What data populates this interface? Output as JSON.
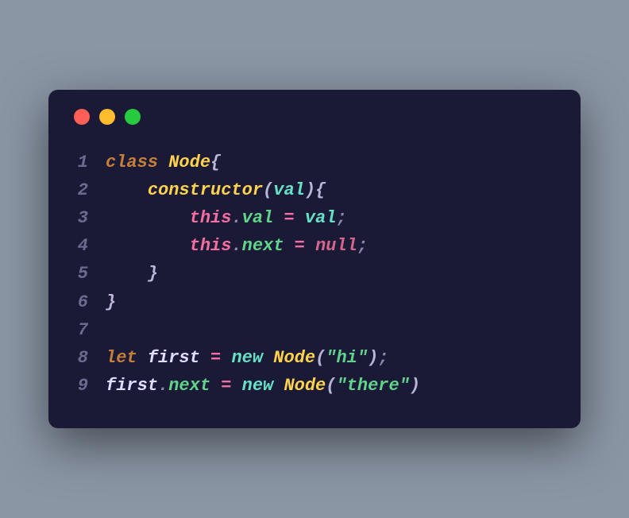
{
  "window": {
    "traffic_lights": {
      "red": "#ff5f56",
      "yellow": "#ffbd2e",
      "green": "#27c93f"
    }
  },
  "editor": {
    "background": "#1b1a36",
    "lineno_color": "#6b6a8f",
    "colors": {
      "keyword": "#c67f3b",
      "class": "#ffd34e",
      "func": "#ffd34e",
      "param": "#66e0c6",
      "this": "#f46ea1",
      "prop": "#5fd48a",
      "op": "#f46ea1",
      "null": "#d4658c",
      "brace": "#b9b6d6",
      "punct": "#8c89b0",
      "let": "#c67f3b",
      "ident": "#e0dcff",
      "new": "#66e0c6",
      "string": "#5fd48a",
      "dot": "#8c89b0"
    },
    "lines": [
      {
        "n": "1",
        "indent": 0,
        "tokens": [
          {
            "t": "class ",
            "c": "keyword"
          },
          {
            "t": "Node",
            "c": "class"
          },
          {
            "t": "{",
            "c": "brace"
          }
        ]
      },
      {
        "n": "2",
        "indent": 1,
        "tokens": [
          {
            "t": "constructor",
            "c": "func"
          },
          {
            "t": "(",
            "c": "brace"
          },
          {
            "t": "val",
            "c": "param"
          },
          {
            "t": ")",
            "c": "brace"
          },
          {
            "t": "{",
            "c": "brace"
          }
        ]
      },
      {
        "n": "3",
        "indent": 2,
        "tokens": [
          {
            "t": "this",
            "c": "this"
          },
          {
            "t": ".",
            "c": "dot"
          },
          {
            "t": "val",
            "c": "prop"
          },
          {
            "t": " = ",
            "c": "op"
          },
          {
            "t": "val",
            "c": "param"
          },
          {
            "t": ";",
            "c": "punct"
          }
        ]
      },
      {
        "n": "4",
        "indent": 2,
        "tokens": [
          {
            "t": "this",
            "c": "this"
          },
          {
            "t": ".",
            "c": "dot"
          },
          {
            "t": "next",
            "c": "prop"
          },
          {
            "t": " = ",
            "c": "op"
          },
          {
            "t": "null",
            "c": "null"
          },
          {
            "t": ";",
            "c": "punct"
          }
        ]
      },
      {
        "n": "5",
        "indent": 1,
        "tokens": [
          {
            "t": "}",
            "c": "brace"
          }
        ]
      },
      {
        "n": "6",
        "indent": 0,
        "tokens": [
          {
            "t": "}",
            "c": "brace"
          }
        ]
      },
      {
        "n": "7",
        "indent": 0,
        "tokens": []
      },
      {
        "n": "8",
        "indent": 0,
        "tokens": [
          {
            "t": "let ",
            "c": "let"
          },
          {
            "t": "first",
            "c": "ident"
          },
          {
            "t": " = ",
            "c": "op"
          },
          {
            "t": "new ",
            "c": "new"
          },
          {
            "t": "Node",
            "c": "class"
          },
          {
            "t": "(",
            "c": "brace"
          },
          {
            "t": "\"hi\"",
            "c": "string"
          },
          {
            "t": ")",
            "c": "brace"
          },
          {
            "t": ";",
            "c": "punct"
          }
        ]
      },
      {
        "n": "9",
        "indent": 0,
        "tokens": [
          {
            "t": "first",
            "c": "ident"
          },
          {
            "t": ".",
            "c": "dot"
          },
          {
            "t": "next",
            "c": "prop"
          },
          {
            "t": " = ",
            "c": "op"
          },
          {
            "t": "new ",
            "c": "new"
          },
          {
            "t": "Node",
            "c": "class"
          },
          {
            "t": "(",
            "c": "brace"
          },
          {
            "t": "\"there\"",
            "c": "string"
          },
          {
            "t": ")",
            "c": "brace"
          }
        ]
      }
    ]
  }
}
